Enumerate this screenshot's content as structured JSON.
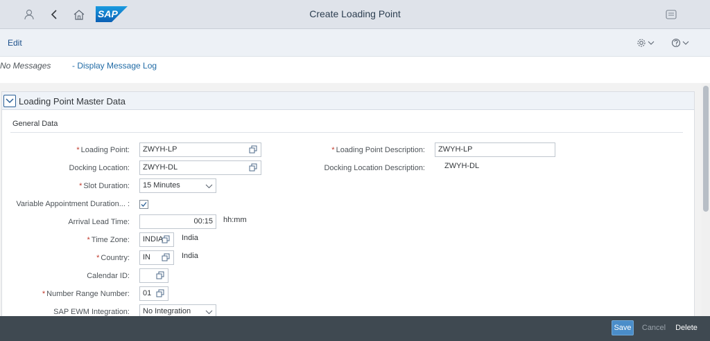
{
  "shell": {
    "title": "Create Loading Point",
    "logo_text": "SAP",
    "icons": [
      "user-icon",
      "back-icon",
      "home-icon",
      "notifications-icon"
    ]
  },
  "toolbar": {
    "edit_label": "Edit",
    "settings_icon": "gear-icon",
    "help_icon": "help-icon"
  },
  "messages": {
    "status": "No Messages",
    "log_link": "- Display Message Log"
  },
  "panel": {
    "title": "Loading Point Master Data",
    "group_title": "General Data"
  },
  "form": {
    "loading_point": {
      "label": "Loading Point:",
      "value": "ZWYH-LP",
      "required": true
    },
    "loading_point_desc": {
      "label": "Loading Point Description:",
      "value": "ZWYH-LP",
      "required": true
    },
    "docking_location": {
      "label": "Docking Location:",
      "value": "ZWYH-DL"
    },
    "docking_location_desc": {
      "label": "Docking Location Description:",
      "value": "ZWYH-DL"
    },
    "slot_duration": {
      "label": "Slot Duration:",
      "value": "15 Minutes",
      "required": true
    },
    "variable_appointment": {
      "label": "Variable Appointment Duration... :",
      "checked": true
    },
    "arrival_lead_time": {
      "label": "Arrival Lead Time:",
      "value": "00:15",
      "unit": "hh:mm"
    },
    "time_zone": {
      "label": "Time Zone:",
      "value": "INDIA",
      "text": "India",
      "required": true
    },
    "country": {
      "label": "Country:",
      "value": "IN",
      "text": "India",
      "required": true
    },
    "calendar_id": {
      "label": "Calendar ID:",
      "value": ""
    },
    "number_range": {
      "label": "Number Range Number:",
      "value": "01",
      "required": true
    },
    "ewm_integration": {
      "label": "SAP EWM Integration:",
      "value": "No Integration"
    }
  },
  "footer": {
    "save": "Save",
    "cancel": "Cancel",
    "delete": "Delete"
  },
  "colors": {
    "shell_bg": "#dfe3ea",
    "footer_bg": "#3f4951",
    "accent": "#4a8dc9",
    "required": "#c0392b"
  }
}
